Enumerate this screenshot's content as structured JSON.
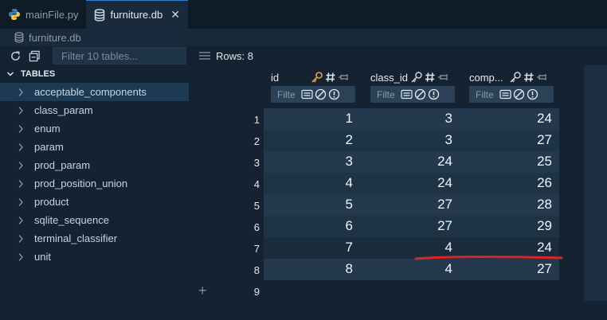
{
  "tabs": [
    {
      "label": "mainFile.py",
      "icon": "python-icon",
      "active": false
    },
    {
      "label": "furniture.db",
      "icon": "database-icon",
      "active": true
    }
  ],
  "breadcrumb": {
    "label": "furniture.db",
    "icon": "database-icon"
  },
  "sidebar": {
    "filter_placeholder": "Filter 10 tables...",
    "section_title": "TABLES",
    "items": [
      {
        "label": "acceptable_components",
        "selected": true
      },
      {
        "label": "class_param"
      },
      {
        "label": "enum"
      },
      {
        "label": "param"
      },
      {
        "label": "prod_param"
      },
      {
        "label": "prod_position_union"
      },
      {
        "label": "product"
      },
      {
        "label": "sqlite_sequence"
      },
      {
        "label": "terminal_classifier"
      },
      {
        "label": "unit"
      }
    ]
  },
  "grid": {
    "rows_label": "Rows: 8",
    "filter_placeholder": "Filte",
    "columns": [
      {
        "name": "id"
      },
      {
        "name": "class_id"
      },
      {
        "name": "comp..."
      }
    ],
    "rows": [
      {
        "num": "1",
        "cells": [
          "1",
          "3",
          "24"
        ]
      },
      {
        "num": "2",
        "cells": [
          "2",
          "3",
          "27"
        ]
      },
      {
        "num": "3",
        "cells": [
          "3",
          "24",
          "25"
        ]
      },
      {
        "num": "4",
        "cells": [
          "4",
          "24",
          "26"
        ]
      },
      {
        "num": "5",
        "cells": [
          "5",
          "27",
          "28"
        ]
      },
      {
        "num": "6",
        "cells": [
          "6",
          "27",
          "29"
        ]
      },
      {
        "num": "7",
        "cells": [
          "7",
          "4",
          "24"
        ]
      },
      {
        "num": "8",
        "cells": [
          "8",
          "4",
          "27"
        ]
      }
    ],
    "new_row_num": "9",
    "add_symbol": "+"
  },
  "colors": {
    "accent": "#2f7ec7",
    "key_icon": "#e8a040",
    "annotation": "#d9262b"
  }
}
